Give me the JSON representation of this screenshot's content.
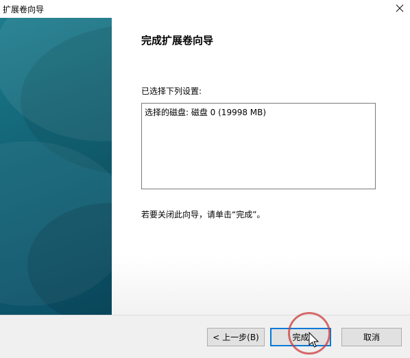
{
  "window": {
    "title": "扩展卷向导"
  },
  "icons": {
    "close": "close-icon",
    "cursor": "mouse-pointer-icon"
  },
  "colors": {
    "side_panel": "#0f5a6f",
    "default_button_border": "#0078d7",
    "highlight_circle": "#cd3c3c"
  },
  "main": {
    "heading": "完成扩展卷向导",
    "selected_label": "已选择下列设置:",
    "settings": [
      "选择的磁盘: 磁盘 0 (19998 MB)"
    ],
    "finish_message": "若要关闭此向导，请单击“完成”。"
  },
  "buttons": {
    "back": "< 上一步(B)",
    "finish": "完成",
    "cancel": "取消"
  }
}
